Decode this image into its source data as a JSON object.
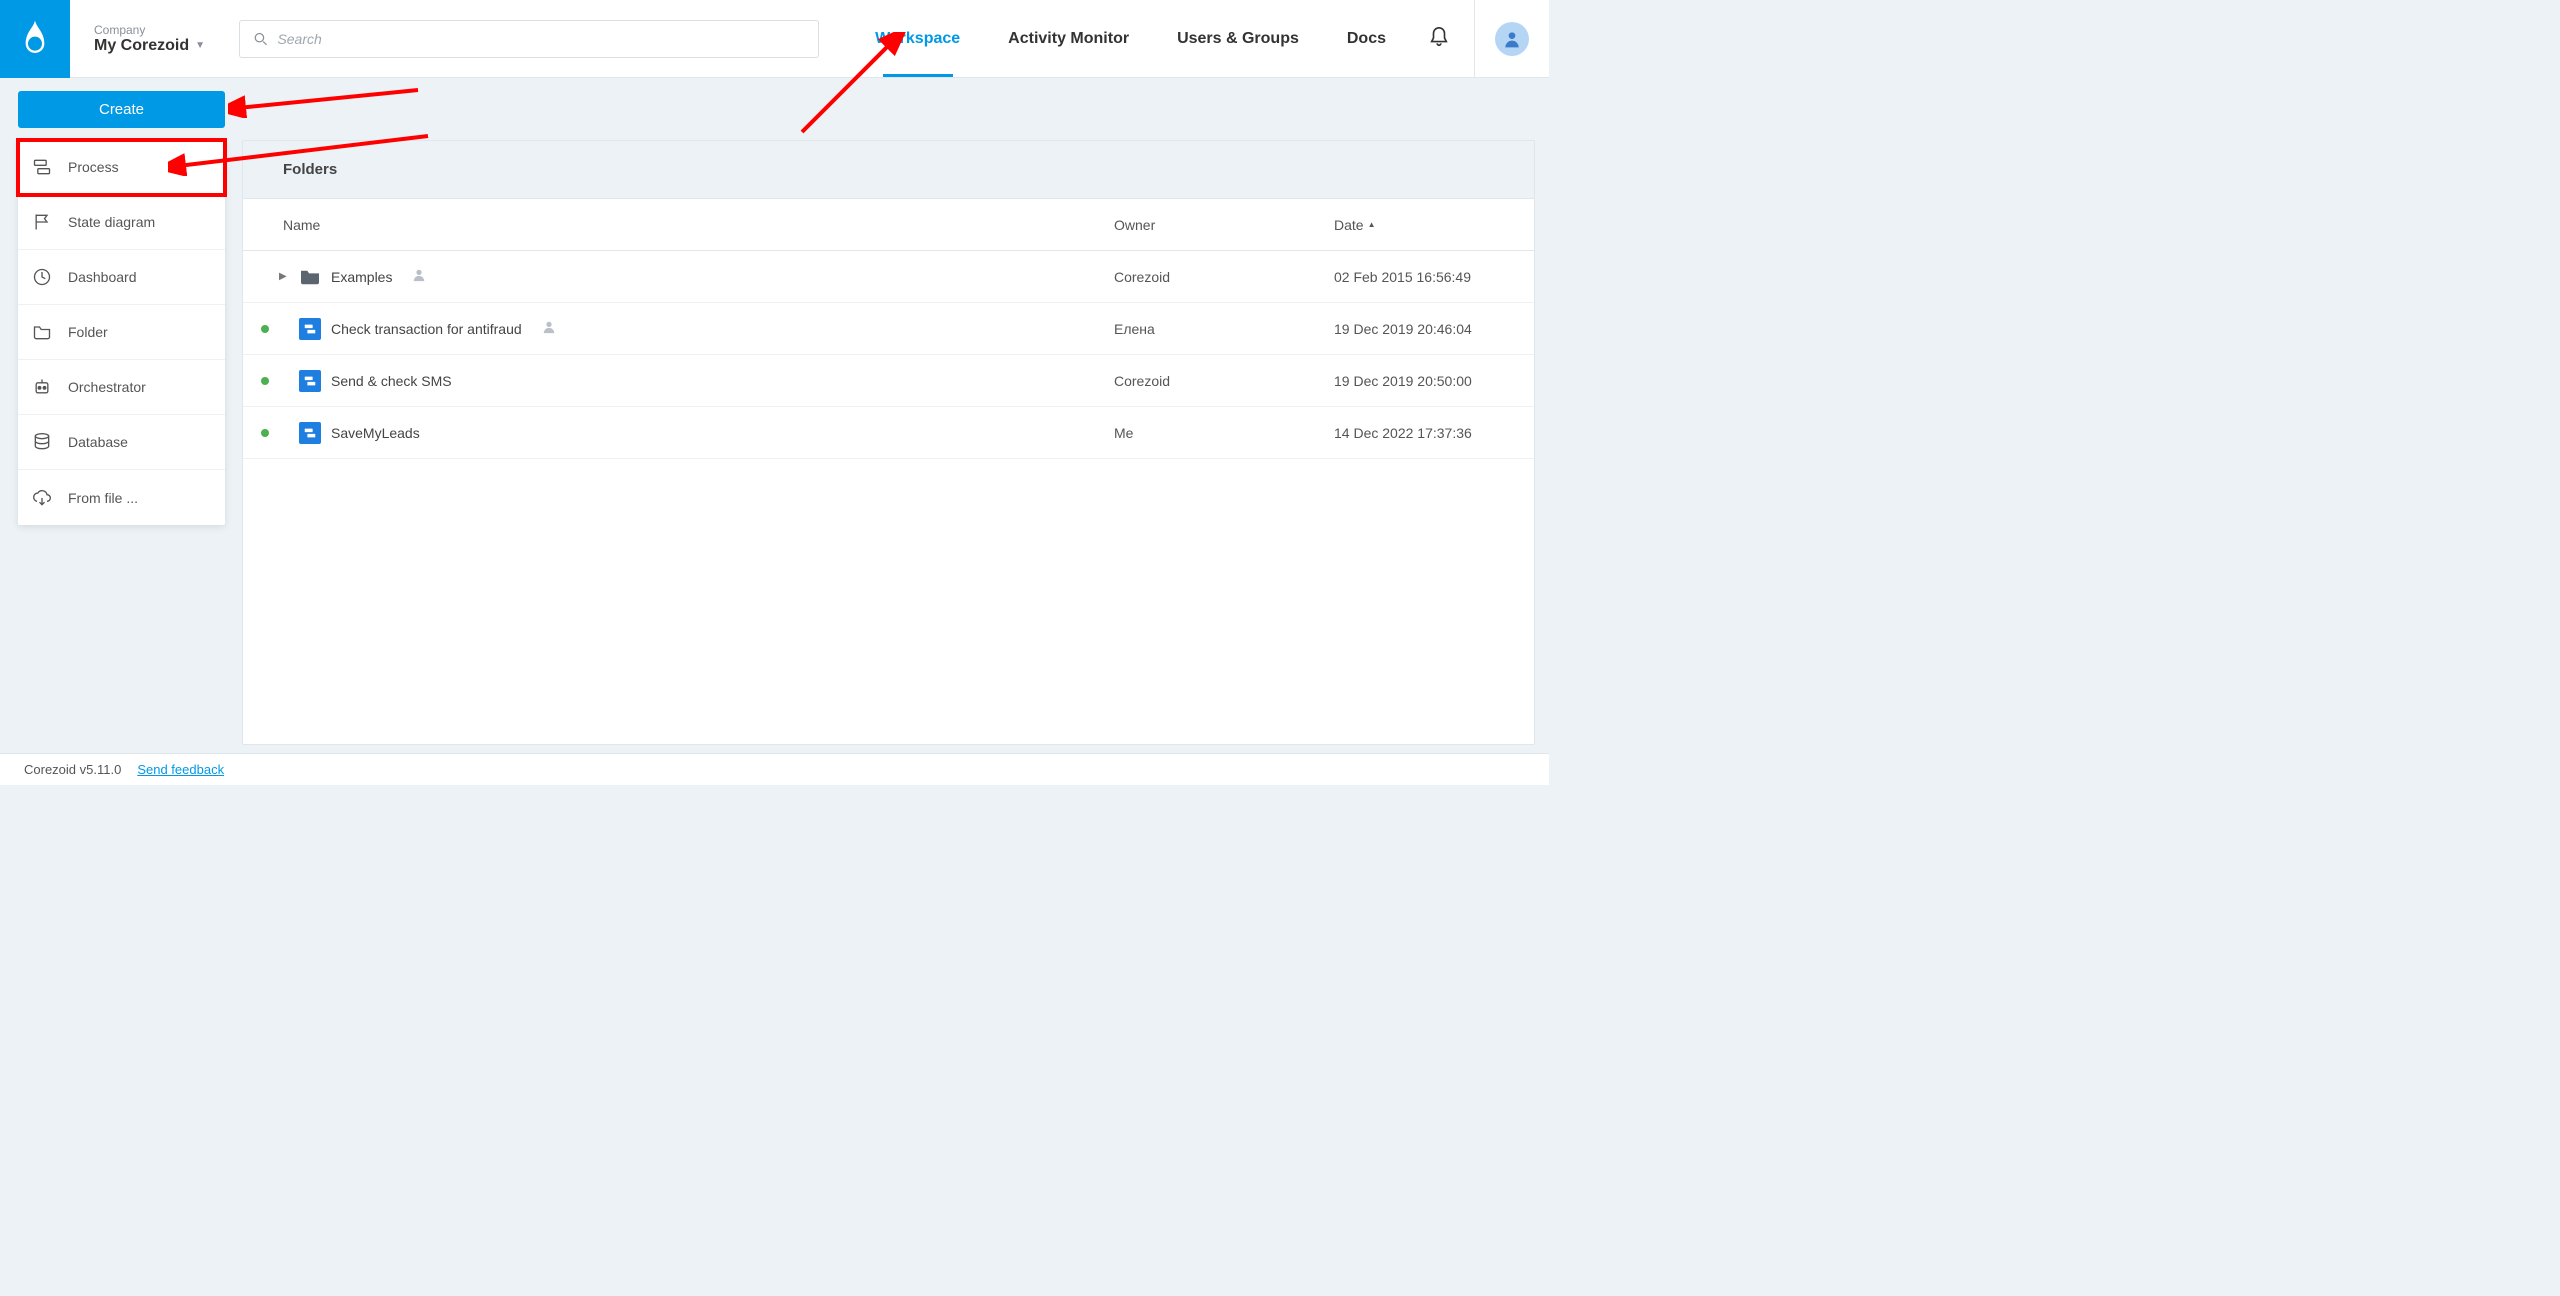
{
  "header": {
    "company_label": "Company",
    "company_name": "My Corezoid",
    "search_placeholder": "Search",
    "nav": {
      "workspace": "Workspace",
      "activity_monitor": "Activity Monitor",
      "users_groups": "Users & Groups",
      "docs": "Docs"
    }
  },
  "create": {
    "button_label": "Create",
    "menu": {
      "process": "Process",
      "state_diagram": "State diagram",
      "dashboard": "Dashboard",
      "folder": "Folder",
      "orchestrator": "Orchestrator",
      "database": "Database",
      "from_file": "From file ..."
    }
  },
  "main": {
    "folders_header": "Folders",
    "columns": {
      "name": "Name",
      "owner": "Owner",
      "date": "Date"
    },
    "rows": [
      {
        "type": "folder",
        "name": "Examples",
        "owner": "Corezoid",
        "date": "02 Feb 2015 16:56:49",
        "status": null,
        "shared": true,
        "expandable": true
      },
      {
        "type": "process",
        "name": "Check transaction for antifraud",
        "owner": "Елена",
        "date": "19 Dec 2019 20:46:04",
        "status": "active",
        "shared": true
      },
      {
        "type": "process",
        "name": "Send & check SMS",
        "owner": "Corezoid",
        "date": "19 Dec 2019 20:50:00",
        "status": "active",
        "shared": false
      },
      {
        "type": "process",
        "name": "SaveMyLeads",
        "owner": "Me",
        "date": "14 Dec 2022 17:37:36",
        "status": "active",
        "shared": false
      }
    ]
  },
  "footer": {
    "version": "Corezoid v5.11.0",
    "feedback": "Send feedback"
  }
}
